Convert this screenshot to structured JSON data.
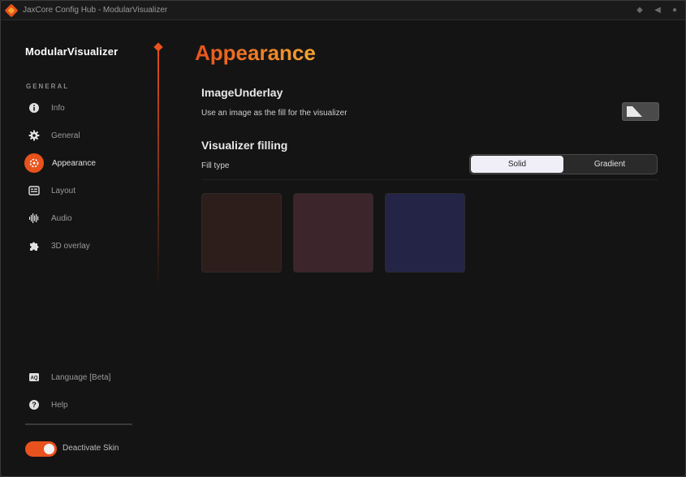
{
  "window": {
    "title": "JaxCore Config Hub - ModularVisualizer"
  },
  "titlebar_icons": [
    "diamond-icon",
    "back-icon",
    "dot-icon"
  ],
  "sidebar": {
    "brand": "ModularVisualizer",
    "section": "GENERAL",
    "items": [
      {
        "label": "Info",
        "icon": "info-icon"
      },
      {
        "label": "General",
        "icon": "gear-icon"
      },
      {
        "label": "Appearance",
        "icon": "palette-icon",
        "active": true
      },
      {
        "label": "Layout",
        "icon": "layout-icon"
      },
      {
        "label": "Audio",
        "icon": "audio-wave-icon"
      },
      {
        "label": "3D overlay",
        "icon": "puzzle-icon"
      }
    ],
    "bottom_items": [
      {
        "label": "Language [Beta]",
        "icon": "language-icon"
      },
      {
        "label": "Help",
        "icon": "help-icon"
      }
    ],
    "skin_toggle": {
      "label": "Deactivate Skin",
      "on": true
    }
  },
  "main": {
    "title": "Appearance",
    "underlay": {
      "heading": "ImageUnderlay",
      "description": "Use an image as the fill for the visualizer"
    },
    "filling": {
      "heading": "Visualizer filling",
      "fill_type_label": "Fill type",
      "options": [
        "Solid",
        "Gradient"
      ],
      "selected": "Solid"
    },
    "swatches": [
      "#2d1e1c",
      "#3d252c",
      "#242447"
    ]
  },
  "colors": {
    "accent": "#e8521c",
    "accent_end": "#f4a531",
    "background": "#141414"
  }
}
